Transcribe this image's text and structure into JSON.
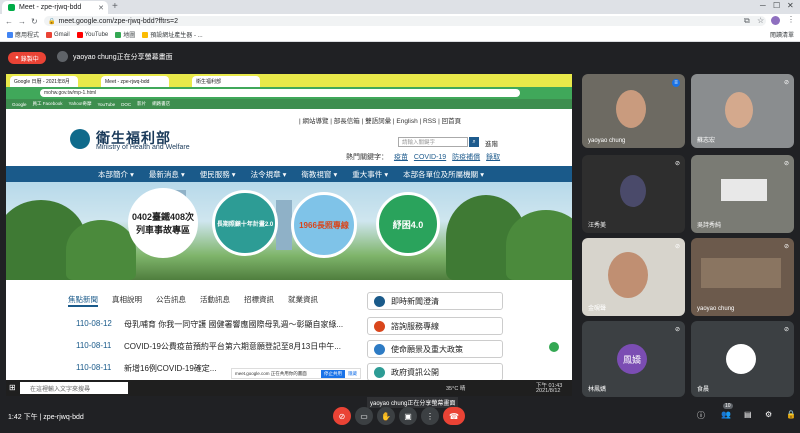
{
  "browser": {
    "tab_title": "Meet - zpe-rjwq-bdd",
    "url": "meet.google.com/zpe-rjwq-bdd?fftrs=2",
    "bookmarks": [
      "應用程式",
      "Gmail",
      "YouTube",
      "地圖",
      "預設網址產生器 - ..."
    ],
    "bookmarks_right": "閱讀清單"
  },
  "meet": {
    "recording_label": "錄製中",
    "presenting_text": "yaoyao chung正在分享螢幕畫面",
    "meeting_time": "1:42 下午",
    "meeting_code": "zpe-rjwq-bdd",
    "tooltip": "yaoyao chung正在分享螢幕畫面",
    "participant_count": "10",
    "accent": "#ea4335"
  },
  "shared": {
    "tabs": [
      "Google 日曆 - 2021年8月",
      "Meet - zpe-rjwq-bdd",
      "衛生福利部"
    ],
    "url": "mohw.gov.tw/mp-1.html",
    "bookmarks": [
      "Google",
      "員工 Facebook",
      "Yahoo!奇摩",
      "YouTube",
      "DOC",
      "影片",
      "網路書店"
    ],
    "top_links": "| 網站導覽 | 部長信箱 | 雙語詞彙 | English | RSS | 回首頁",
    "brand": "衛生福利部",
    "brand_en": "Ministry of Health and Welfare",
    "search_placeholder": "請輸入關鍵字",
    "adv_search": "進階",
    "hot_label": "熱門關鍵字：",
    "hot_keywords": [
      "疫苗",
      "COVID-19",
      "防疫補償",
      "錄取"
    ],
    "nav": [
      "本部簡介 ▾",
      "最新消息 ▾",
      "便民服務 ▾",
      "法令規章 ▾",
      "衛教視窗 ▾",
      "重大事件 ▾",
      "本部各單位及所屬機關 ▾"
    ],
    "banners": [
      "0402臺鐵408次列車事故專區",
      "長期照顧十年計畫2.0",
      "1966長照專線",
      "紓困4.0"
    ],
    "news_tabs": [
      "焦點新聞",
      "真相說明",
      "公告訊息",
      "活動訊息",
      "招標資訊",
      "就業資訊"
    ],
    "news": [
      {
        "date": "110-08-12",
        "title": "母乳哺育 你我一同守護 國健署響應國際母乳週～彰顯自家綠..."
      },
      {
        "date": "110-08-11",
        "title": "COVID-19公費疫苗預約平台第六期意願登記至8月13日中午..."
      },
      {
        "date": "110-08-11",
        "title": "新增16例COVID-19確定..."
      }
    ],
    "side_buttons": [
      "即時新聞澄清",
      "諮詢服務專線",
      "使命願景及重大政策",
      "政府資訊公開"
    ],
    "meet_notice": "meet.google.com 正在共用你的畫面",
    "meet_notice_btn": "停止共用",
    "meet_notice_hide": "隱藏",
    "taskbar_search": "在這裡輸入文字來搜尋",
    "taskbar_temp": "35°C 晴",
    "taskbar_time": "下午 01:43",
    "taskbar_date": "2021/8/12"
  },
  "participants": [
    "yaoyao chung",
    "蘇志宏",
    "汪秀美",
    "吳詩秀純",
    "金硯聲",
    "yaoyao chung",
    "林鳳嬌",
    "食晨"
  ],
  "avatar_text": "鳳嬌"
}
